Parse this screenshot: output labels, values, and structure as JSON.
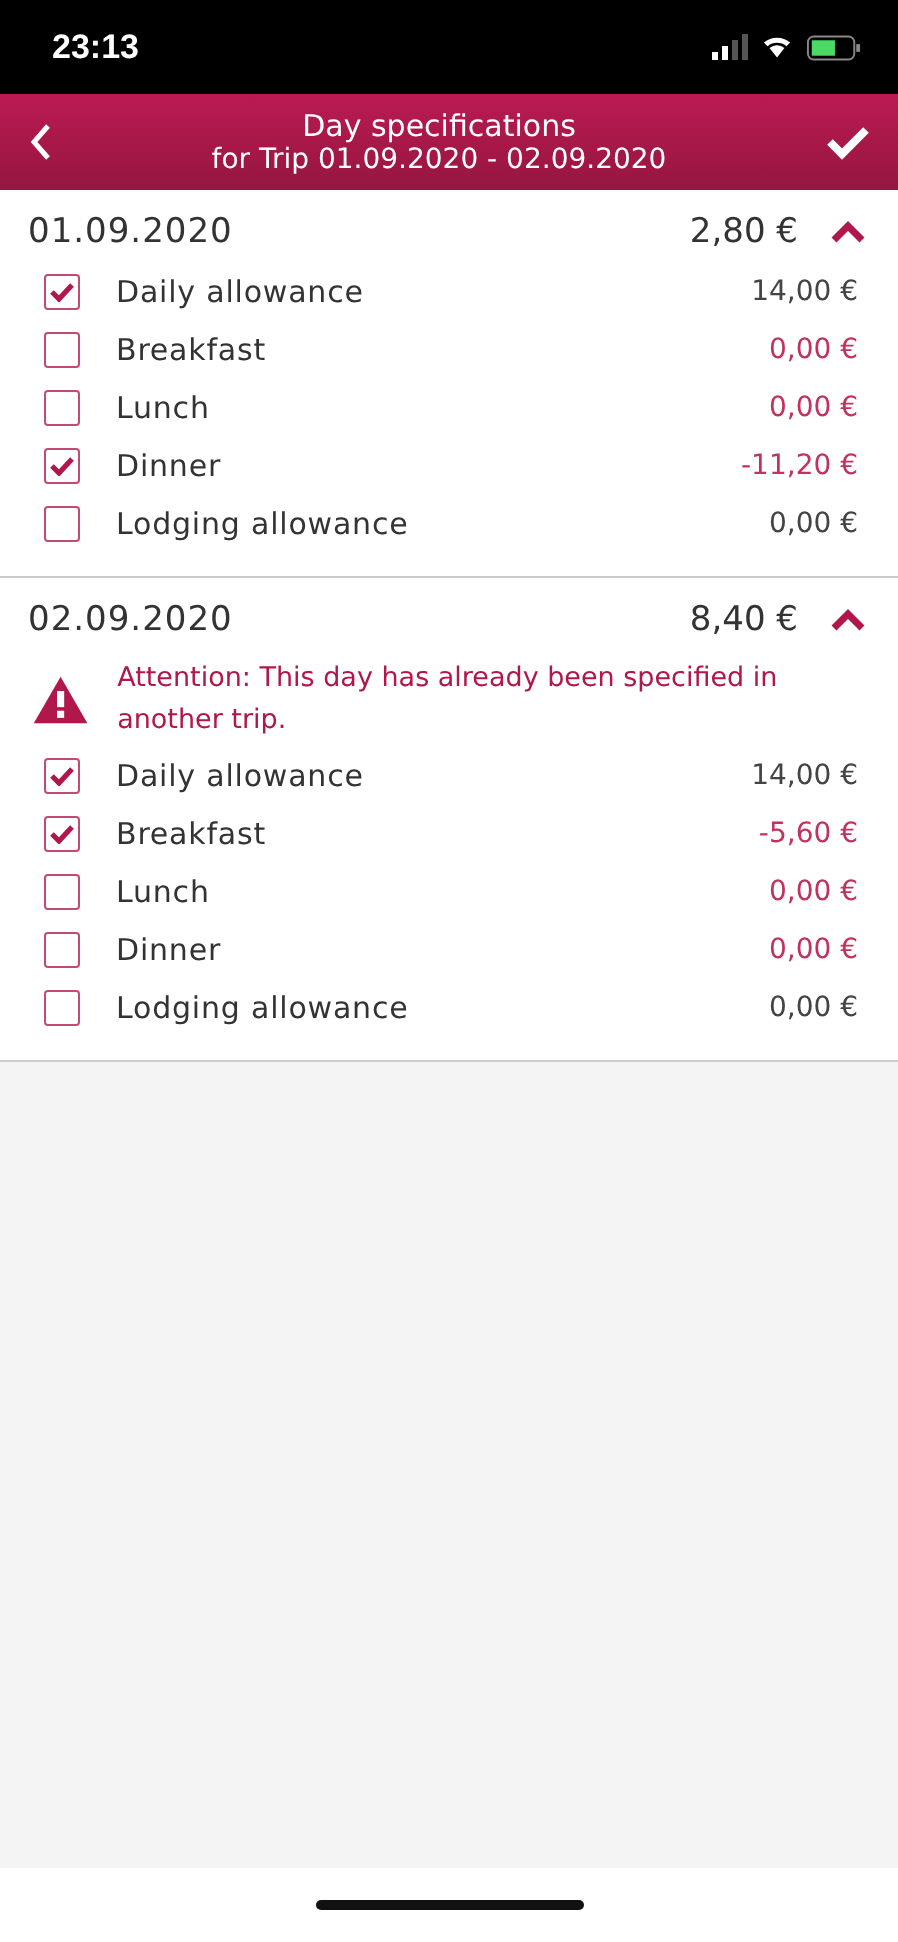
{
  "status_bar": {
    "time": "23:13"
  },
  "header": {
    "title": "Day specifications",
    "subtitle": "for Trip 01.09.2020 - 02.09.2020"
  },
  "days": [
    {
      "date": "01.09.2020",
      "total": "2,80 €",
      "expanded": true,
      "items": [
        {
          "label": "Daily allowance",
          "amount": "14,00 €",
          "checked": true,
          "kind": "allowance"
        },
        {
          "label": "Breakfast",
          "amount": "0,00 €",
          "checked": false,
          "kind": "meal"
        },
        {
          "label": "Lunch",
          "amount": "0,00 €",
          "checked": false,
          "kind": "meal"
        },
        {
          "label": "Dinner",
          "amount": "-11,20 €",
          "checked": true,
          "kind": "meal"
        },
        {
          "label": "Lodging allowance",
          "amount": "0,00 €",
          "checked": false,
          "kind": "allowance"
        }
      ]
    },
    {
      "date": "02.09.2020",
      "total": "8,40 €",
      "expanded": true,
      "warning": "Attention: This day has already been specified in another trip.",
      "items": [
        {
          "label": "Daily allowance",
          "amount": "14,00 €",
          "checked": true,
          "kind": "allowance"
        },
        {
          "label": "Breakfast",
          "amount": "-5,60 €",
          "checked": true,
          "kind": "meal"
        },
        {
          "label": "Lunch",
          "amount": "0,00 €",
          "checked": false,
          "kind": "meal"
        },
        {
          "label": "Dinner",
          "amount": "0,00 €",
          "checked": false,
          "kind": "meal"
        },
        {
          "label": "Lodging allowance",
          "amount": "0,00 €",
          "checked": false,
          "kind": "allowance"
        }
      ]
    }
  ]
}
